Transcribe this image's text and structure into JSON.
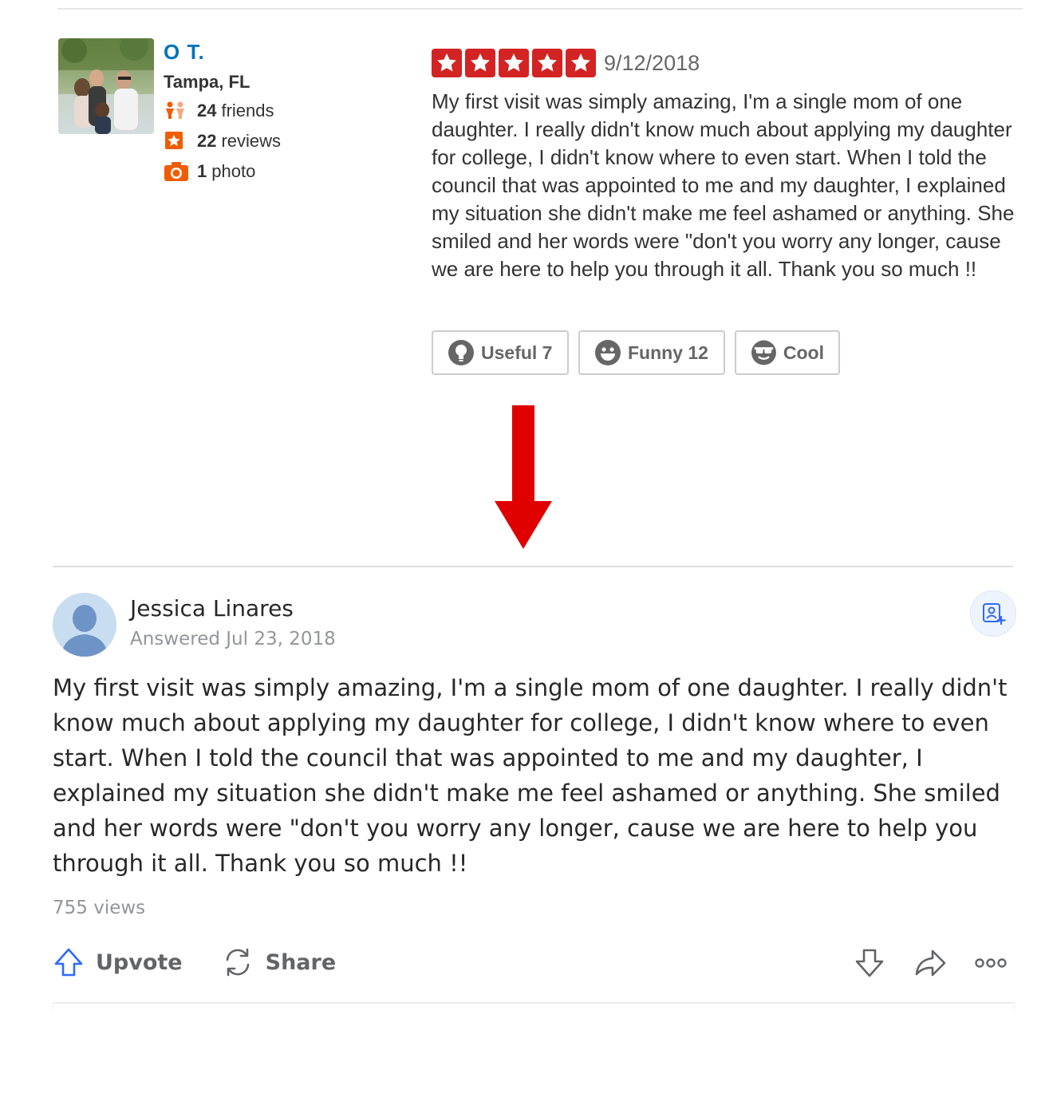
{
  "yelp_review": {
    "user": {
      "name": "O T.",
      "location": "Tampa, FL",
      "friends_count": "24",
      "friends_label": "friends",
      "reviews_count": "22",
      "reviews_label": "reviews",
      "photos_count": "1",
      "photos_label": "photo"
    },
    "rating": 5,
    "date": "9/12/2018",
    "text": "My first visit was simply amazing, I'm a single mom of one daughter. I really didn't know much about applying my daughter for college, I didn't know where to even start. When I told the council that was appointed to me and my daughter, I explained my situation she didn't make me feel ashamed or anything. She smiled and her words were \"don't you worry any longer, cause we are here to help you through it all. Thank you so much !!",
    "votes": {
      "useful_label": "Useful 7",
      "funny_label": "Funny 12",
      "cool_label": "Cool"
    },
    "colors": {
      "star": "#d32323",
      "name": "#0073bb"
    }
  },
  "arrow": {
    "color": "#e00000",
    "icon": "down-arrow"
  },
  "quora_answer": {
    "author": "Jessica Linares",
    "answered": "Answered Jul 23, 2018",
    "text": "My first visit was simply amazing, I'm a single mom of one daughter. I really didn't know much about applying my daughter for college, I didn't know where to even start. When I told the council that was appointed to me and my daughter, I explained my situation she didn't make me feel ashamed or anything. She smiled and her words were \"don't you worry any longer, cause we are here to help you through it all. Thank you so much !!",
    "views": "755 views",
    "actions": {
      "upvote_label": "Upvote",
      "share_label": "Share"
    },
    "colors": {
      "upvote": "#2e69ff"
    }
  }
}
